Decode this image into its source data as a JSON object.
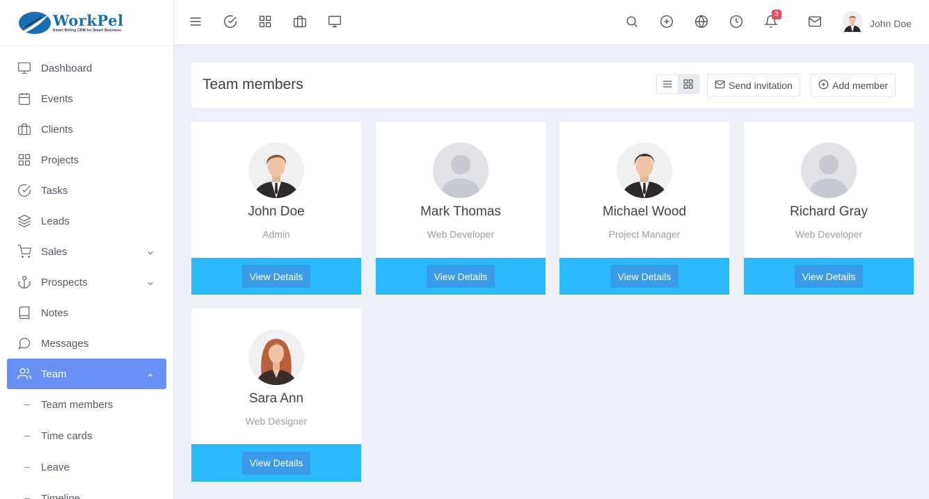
{
  "brand": {
    "name": "WorkPel",
    "tagline": "Smart Billing CRM for Smart Business"
  },
  "sidebar": {
    "items": [
      {
        "label": "Dashboard",
        "icon": "monitor-icon"
      },
      {
        "label": "Events",
        "icon": "calendar-icon"
      },
      {
        "label": "Clients",
        "icon": "briefcase-icon"
      },
      {
        "label": "Projects",
        "icon": "grid-icon"
      },
      {
        "label": "Tasks",
        "icon": "check-circle-icon"
      },
      {
        "label": "Leads",
        "icon": "layers-icon"
      },
      {
        "label": "Sales",
        "icon": "cart-icon",
        "expandable": true
      },
      {
        "label": "Prospects",
        "icon": "anchor-icon",
        "expandable": true
      },
      {
        "label": "Notes",
        "icon": "book-icon"
      },
      {
        "label": "Messages",
        "icon": "message-icon"
      },
      {
        "label": "Team",
        "icon": "users-icon",
        "expandable": true,
        "active": true
      }
    ],
    "subitems": [
      "Team members",
      "Time cards",
      "Leave",
      "Timeline"
    ],
    "active_color": "#6690f4"
  },
  "topbar": {
    "notifications_count": "3",
    "user_name": "John Doe"
  },
  "page": {
    "title": "Team members",
    "send_invitation": "Send invitation",
    "add_member": "Add member"
  },
  "members": [
    {
      "name": "John Doe",
      "role": "Admin",
      "avatar": "man-brown-hair"
    },
    {
      "name": "Mark Thomas",
      "role": "Web Developer",
      "avatar": "placeholder"
    },
    {
      "name": "Michael Wood",
      "role": "Project Manager",
      "avatar": "man-dark-hair"
    },
    {
      "name": "Richard Gray",
      "role": "Web Developer",
      "avatar": "placeholder"
    },
    {
      "name": "Sara Ann",
      "role": "Web Designer",
      "avatar": "woman-red-hair"
    }
  ],
  "card_button_label": "View Details",
  "colors": {
    "card_footer": "#2ab9fb",
    "card_button": "#3a9be8",
    "badge": "#e74c5e"
  }
}
